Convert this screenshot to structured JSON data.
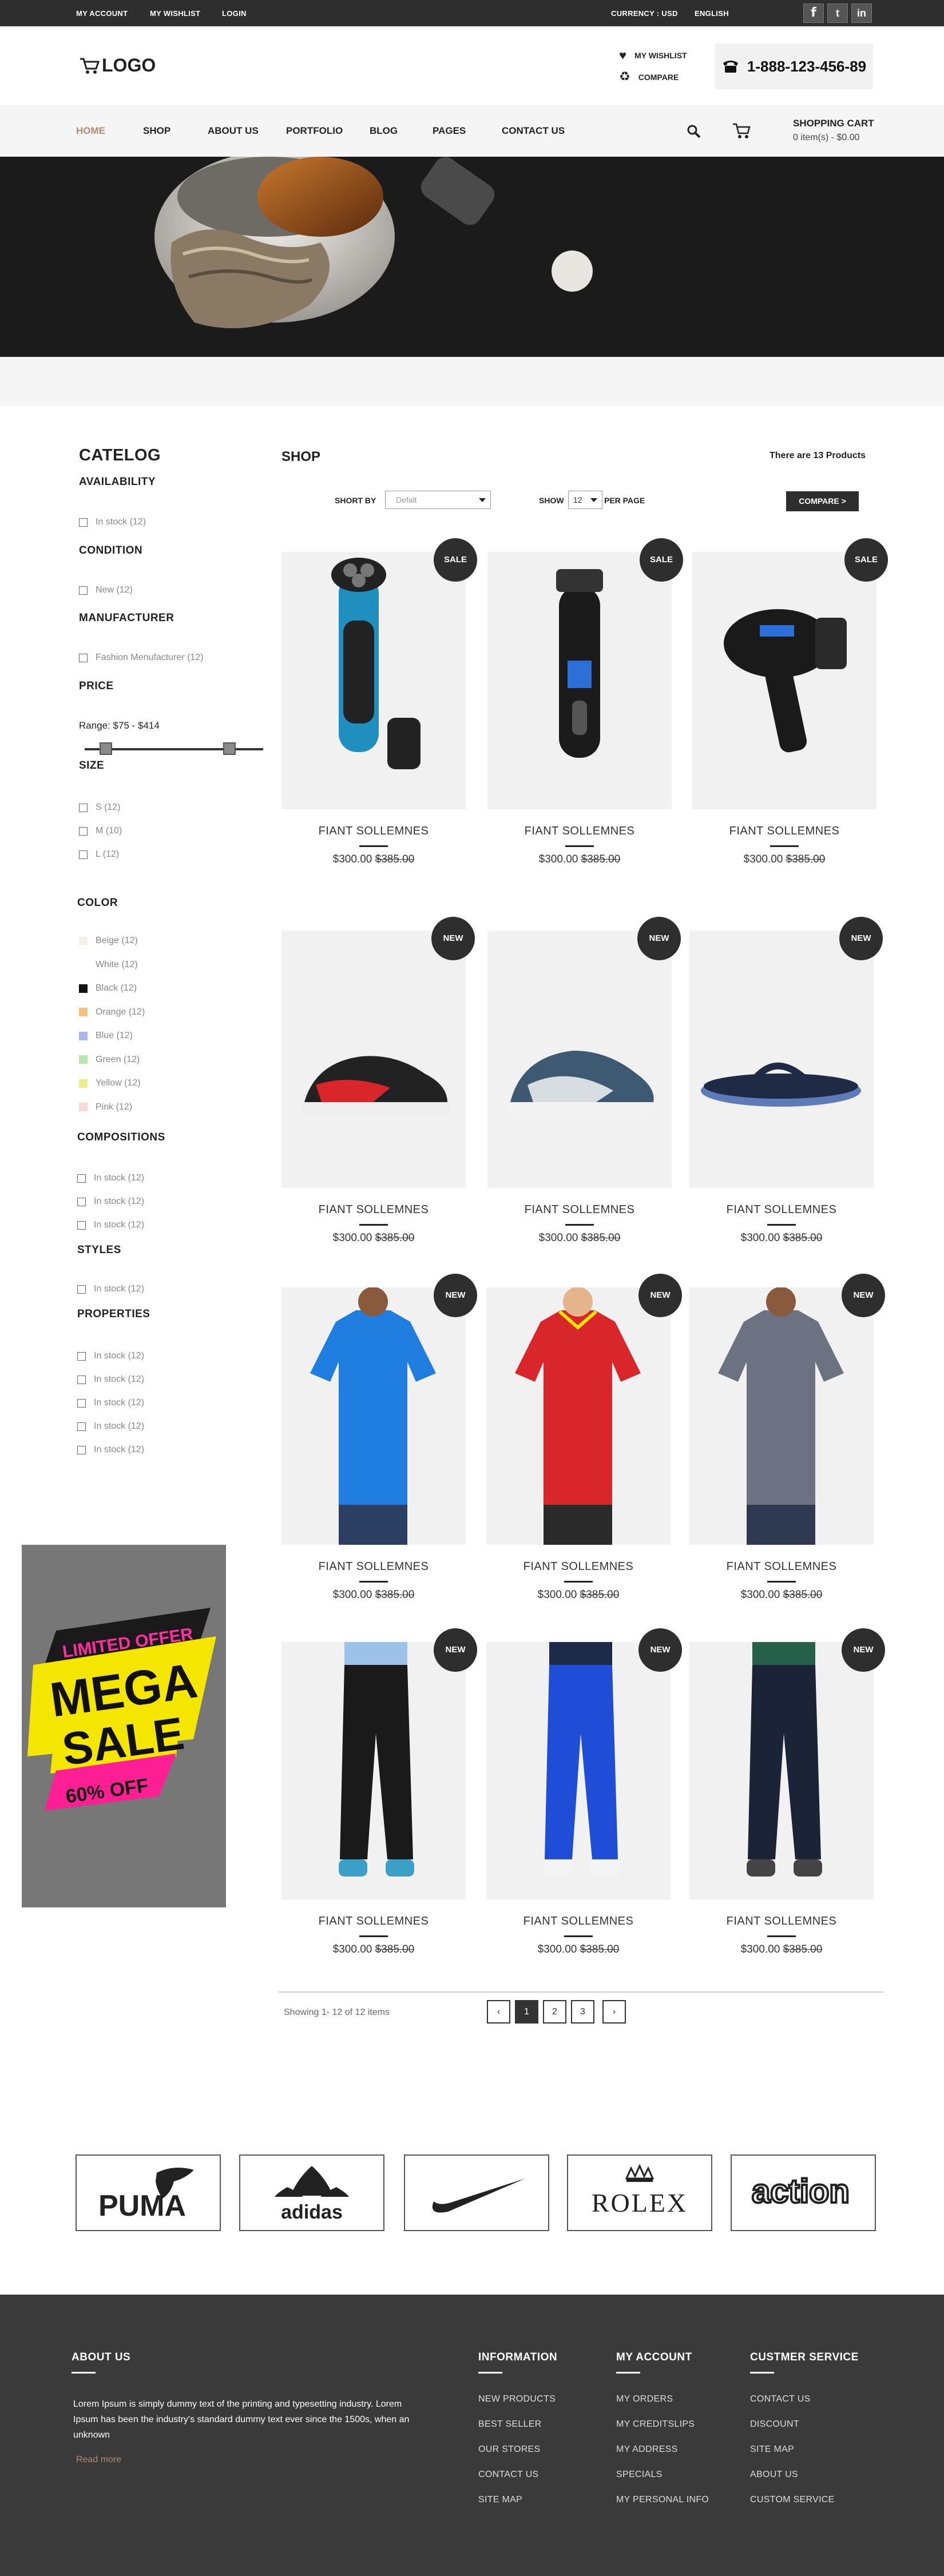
{
  "topbar": {
    "my_account": "MY ACCOUNT",
    "my_wishlist": "MY WISHLIST",
    "login": "LOGIN",
    "currency": "CURRENCY : USD",
    "language": "ENGLISH",
    "social": [
      "f",
      "t",
      "in"
    ]
  },
  "header": {
    "logo": "LOGO",
    "wishlist": "MY WISHLIST",
    "compare": "COMPARE",
    "phone": "1-888-123-456-89"
  },
  "nav": {
    "items": [
      "HOME",
      "SHOP",
      "ABOUT US",
      "PORTFOLIO",
      "BLOG",
      "PAGES",
      "CONTACT US"
    ],
    "cart_title": "SHOPPING CART",
    "cart_sub": "0 item(s) - $0.00"
  },
  "sidebar": {
    "catalog": "CATELOG",
    "availability": "AVAILABILITY",
    "availability_item": "In stock (12)",
    "condition": "CONDITION",
    "condition_item": "New (12)",
    "manufacturer": "MANUFACTURER",
    "manufacturer_item": "Fashion Menufacturer (12)",
    "price": "PRICE",
    "range": "Range: $75 - $414",
    "size": "SIZE",
    "sizes": [
      "S (12)",
      "M (10)",
      "L (12)"
    ],
    "color": "COLOR",
    "colors": [
      {
        "label": "Beige (12)",
        "hex": "#f5f0e1"
      },
      {
        "label": "White (12)",
        "hex": "#ffffff"
      },
      {
        "label": "Black (12)",
        "hex": "#111111"
      },
      {
        "label": "Orange (12)",
        "hex": "#f4c27a"
      },
      {
        "label": "Blue (12)",
        "hex": "#a8b8e8"
      },
      {
        "label": "Green (12)",
        "hex": "#b8e6b0"
      },
      {
        "label": "Yellow (12)",
        "hex": "#ecec8c"
      },
      {
        "label": "Pink (12)",
        "hex": "#fbd9d3"
      }
    ],
    "compositions": "COMPOSITIONS",
    "compositions_items": [
      "In stock (12)",
      "In stock (12)",
      "In stock (12)"
    ],
    "styles": "STYLES",
    "styles_item": "In stock (12)",
    "properties": "PROPERTIES",
    "properties_items": [
      "In stock (12)",
      "In stock (12)",
      "In stock (12)",
      "In stock (12)",
      "In stock (12)"
    ],
    "promo": {
      "line1": "LIMITED OFFER",
      "line2": "MEGA",
      "line3": "SALE",
      "line4": "60% OFF"
    }
  },
  "shop": {
    "title": "SHOP",
    "count": "There are 13 Products",
    "sort_label": "SHORT BY",
    "sort_value": "Defalt",
    "show_label": "SHOW",
    "show_value": "12",
    "per_page": "PER PAGE",
    "compare_button": "COMPARE >"
  },
  "products": [
    {
      "name": "FIANT SOLLEMNES",
      "price": "$300.00",
      "old_price": "$385.00",
      "badge": "SALE"
    },
    {
      "name": "FIANT SOLLEMNES",
      "price": "$300.00",
      "old_price": "$385.00",
      "badge": "SALE"
    },
    {
      "name": "FIANT SOLLEMNES",
      "price": "$300.00",
      "old_price": "$385.00",
      "badge": "SALE"
    },
    {
      "name": "FIANT SOLLEMNES",
      "price": "$300.00",
      "old_price": "$385.00",
      "badge": "NEW"
    },
    {
      "name": "FIANT SOLLEMNES",
      "price": "$300.00",
      "old_price": "$385.00",
      "badge": "NEW"
    },
    {
      "name": "FIANT SOLLEMNES",
      "price": "$300.00",
      "old_price": "$385.00",
      "badge": "NEW"
    },
    {
      "name": "FIANT SOLLEMNES",
      "price": "$300.00",
      "old_price": "$385.00",
      "badge": "NEW"
    },
    {
      "name": "FIANT SOLLEMNES",
      "price": "$300.00",
      "old_price": "$385.00",
      "badge": "NEW"
    },
    {
      "name": "FIANT SOLLEMNES",
      "price": "$300.00",
      "old_price": "$385.00",
      "badge": "NEW"
    },
    {
      "name": "FIANT SOLLEMNES",
      "price": "$300.00",
      "old_price": "$385.00",
      "badge": "NEW"
    },
    {
      "name": "FIANT SOLLEMNES",
      "price": "$300.00",
      "old_price": "$385.00",
      "badge": "NEW"
    },
    {
      "name": "FIANT SOLLEMNES",
      "price": "$300.00",
      "old_price": "$385.00",
      "badge": "NEW"
    }
  ],
  "pagination": {
    "showing": "Showing 1- 12 of 12 items",
    "prev": "‹",
    "pages": [
      "1",
      "2",
      "3"
    ],
    "next": "›"
  },
  "brands": [
    "PUMA",
    "adidas",
    "NIKE",
    "ROLEX",
    "action"
  ],
  "footer": {
    "about_title": "ABOUT US",
    "about_text": "Lorem Ipsum is simply dummy text of the printing and typesetting industry. Lorem Ipsum has been the industry's standard dummy text ever since the 1500s, when an unknown",
    "read_more": "Read more",
    "info_title": "INFORMATION",
    "info_links": [
      "NEW PRODUCTS",
      "BEST SELLER",
      "OUR STORES",
      "CONTACT US",
      "SITE MAP"
    ],
    "account_title": "MY ACCOUNT",
    "account_links": [
      "MY ORDERS",
      "MY CREDITSLIPS",
      "MY ADDRESS",
      "SPECIALS",
      "MY PERSONAL INFO"
    ],
    "service_title": "CUSTMER SERVICE",
    "service_links": [
      "CONTACT US",
      "DISCOUNT",
      "SITE MAP",
      "ABOUT US",
      "CUSTOM SERVICE"
    ]
  }
}
